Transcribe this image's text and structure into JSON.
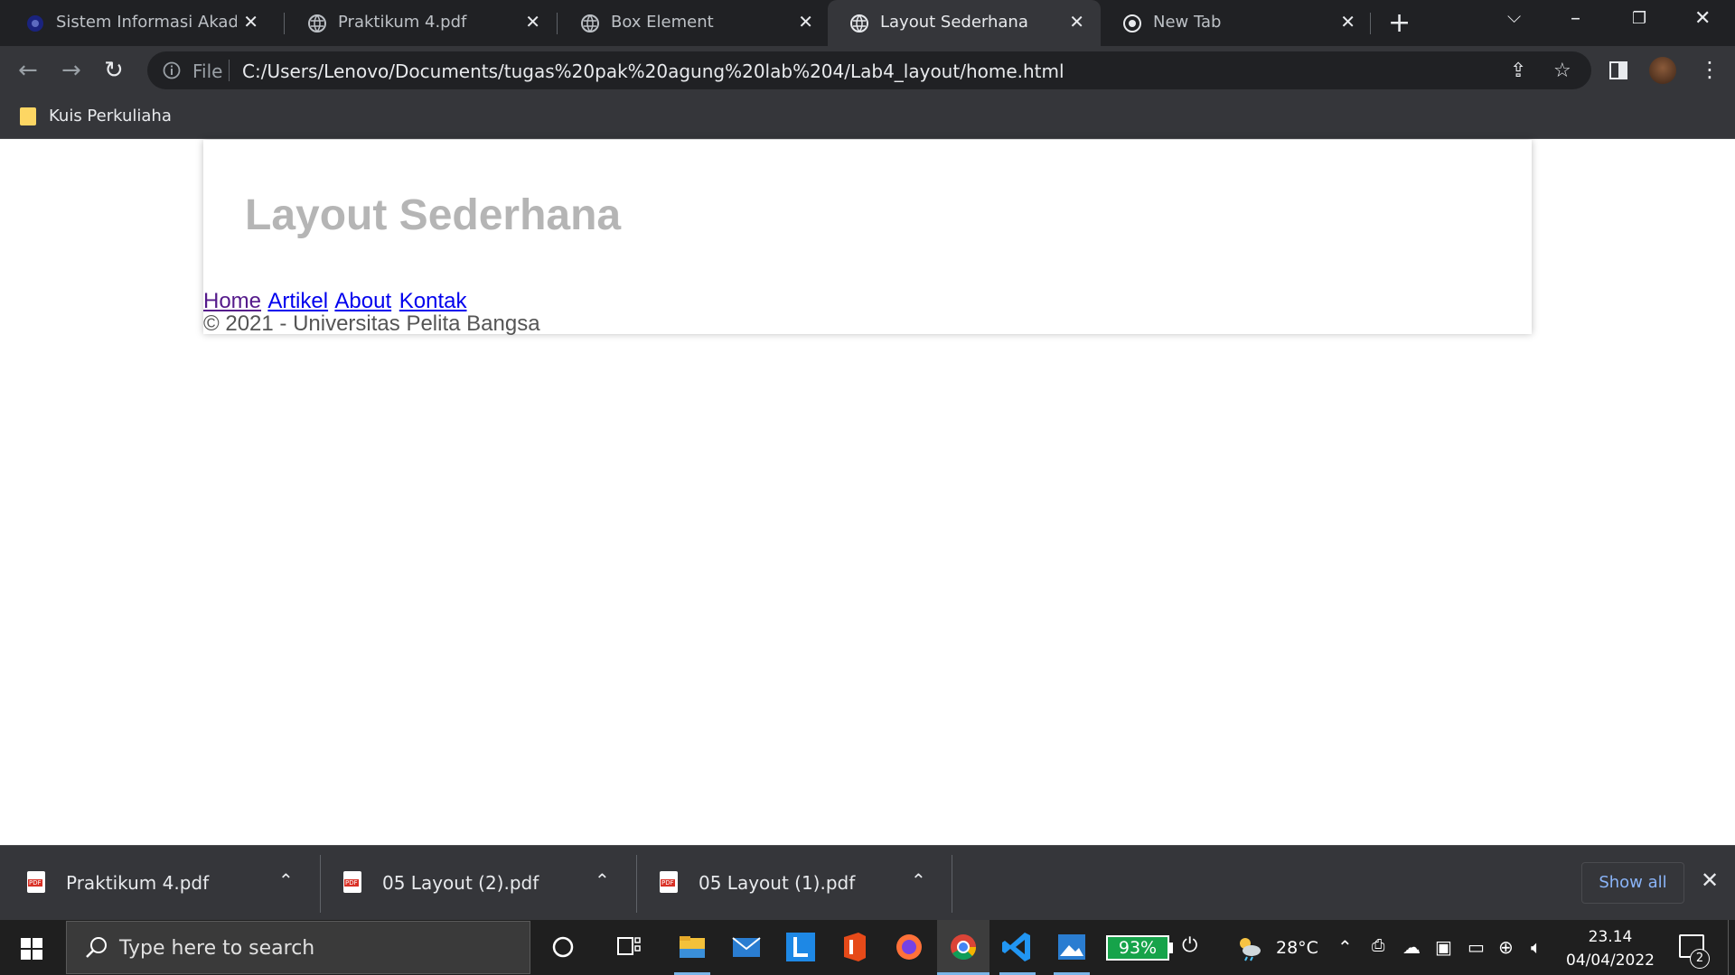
{
  "browser": {
    "tabs": [
      {
        "title": "Sistem Informasi Akademik",
        "active": false
      },
      {
        "title": "Praktikum 4.pdf",
        "active": false
      },
      {
        "title": "Box Element",
        "active": false
      },
      {
        "title": "Layout Sederhana",
        "active": true
      },
      {
        "title": "New Tab",
        "active": false
      }
    ],
    "omnibox": {
      "scheme_label": "File",
      "url": "C:/Users/Lenovo/Documents/tugas%20pak%20agung%20lab%204/Lab4_layout/home.html"
    },
    "bookmarks": [
      {
        "label": "Kuis Perkuliaha"
      }
    ]
  },
  "page": {
    "title": "Layout Sederhana",
    "nav": [
      "Home",
      "Artikel",
      "About",
      "Kontak"
    ],
    "footer": "© 2021 - Universitas Pelita Bangsa"
  },
  "downloads": {
    "items": [
      {
        "name": "Praktikum 4.pdf"
      },
      {
        "name": "05 Layout (2).pdf"
      },
      {
        "name": "05 Layout (1).pdf"
      }
    ],
    "show_all_label": "Show all"
  },
  "taskbar": {
    "search_placeholder": "Type here to search",
    "battery": "93%",
    "temperature": "28°C",
    "time": "23.14",
    "date": "04/04/2022",
    "notification_count": "2",
    "colors": {
      "accent": "#7ab5e8",
      "battery": "#16a34a"
    }
  }
}
